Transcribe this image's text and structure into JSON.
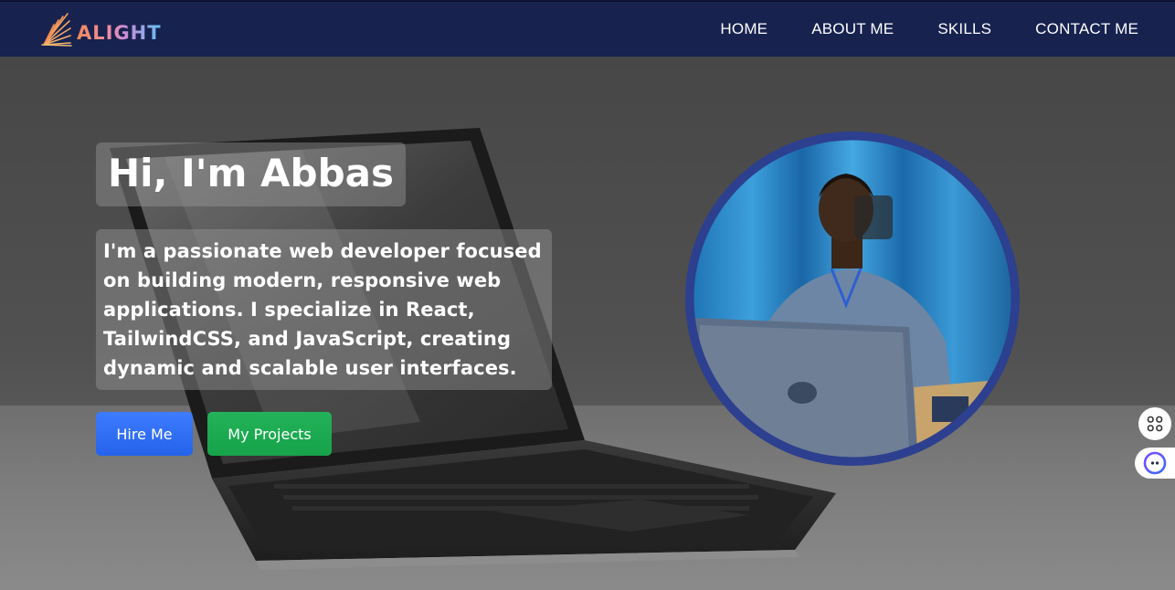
{
  "navbar": {
    "logo_text": "ALIGHT",
    "links": [
      {
        "label": "HOME"
      },
      {
        "label": "ABOUT ME"
      },
      {
        "label": "SKILLS"
      },
      {
        "label": "CONTACT ME"
      }
    ]
  },
  "hero": {
    "title": "Hi, I'm Abbas",
    "description": "I'm a passionate web developer focused on building modern, responsive web applications. I specialize in React, TailwindCSS, and JavaScript, creating dynamic and scalable user interfaces.",
    "buttons": {
      "hire_label": "Hire Me",
      "projects_label": "My Projects"
    }
  },
  "widgets": {
    "apps_icon": "apps-grid-icon",
    "assistant_icon": "assistant-bot-icon"
  },
  "colors": {
    "navbar_bg": "#17224f",
    "hire_button": "#2563eb",
    "projects_button": "#16a34a",
    "profile_ring": "#2d3f8f"
  }
}
